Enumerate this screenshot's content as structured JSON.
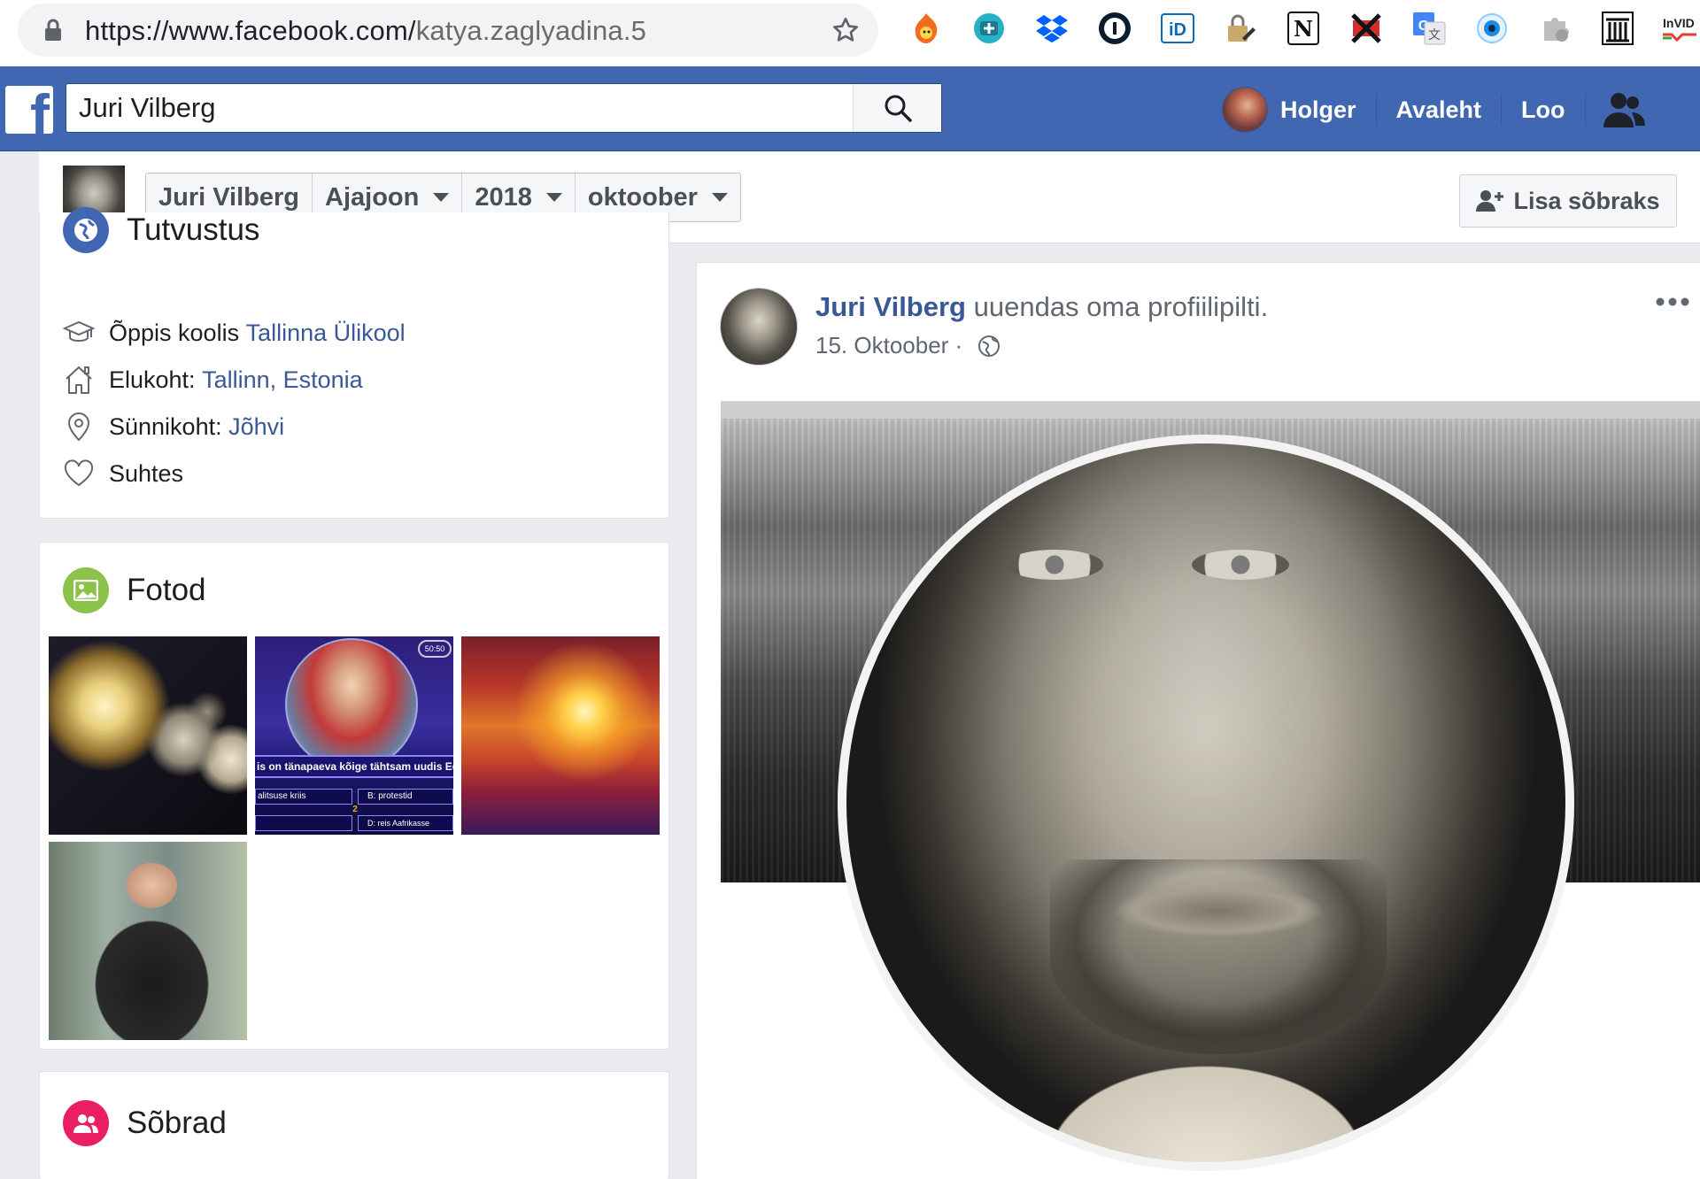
{
  "browser": {
    "url_host": "https://www.facebook.com/",
    "url_path": "katya.zaglyadina.5",
    "extensions": [
      "hotspot-shield-icon",
      "extension-plus-icon",
      "dropbox-icon",
      "onepassword-icon",
      "id-icon",
      "lock-pen-icon",
      "notion-icon",
      "crossed-extension-icon",
      "google-translate-icon",
      "eye-extension-icon",
      "puzzle-extension-icon",
      "archive-icon",
      "invid-icon"
    ],
    "invid_label": "InVID"
  },
  "fb_nav": {
    "search_value": "Juri Vilberg",
    "user_name": "Holger",
    "home_label": "Avaleht",
    "create_label": "Loo"
  },
  "timeline_header": {
    "name": "Juri Vilberg",
    "section": "Ajajoon",
    "year": "2018",
    "month": "oktoober",
    "add_friend_label": "Lisa sõbraks"
  },
  "intro": {
    "title": "Tutvustus",
    "study_prefix": "Õppis koolis ",
    "study_link": "Tallinna Ülikool",
    "lives_prefix": "Elukoht: ",
    "lives_link": "Tallinn, Estonia",
    "born_prefix": "Sünnikoht: ",
    "born_link": "Jõhvi",
    "relationship": "Suhtes"
  },
  "photos": {
    "title": "Fotod",
    "tv_caption": "is on tänapaeva kõige tähtsam uudis Eesti",
    "tv_option_a": "alitsuse kriis",
    "tv_option_b": "B: protestid",
    "tv_option_c": "D: reis Aafrikasse",
    "tv_badge": "50:50",
    "tv_mid": "2"
  },
  "friends": {
    "title": "Sõbrad"
  },
  "post": {
    "author": "Juri Vilberg",
    "action": " uuendas oma profiilipilti.",
    "date": "15. Oktoober",
    "date_sep": " · "
  },
  "colors": {
    "fb_blue": "#4267b2",
    "link_blue": "#385898",
    "photos_icon_green": "#8bc34a",
    "friends_icon_pink": "#e91e63",
    "intro_icon_blue": "#4267b2"
  }
}
